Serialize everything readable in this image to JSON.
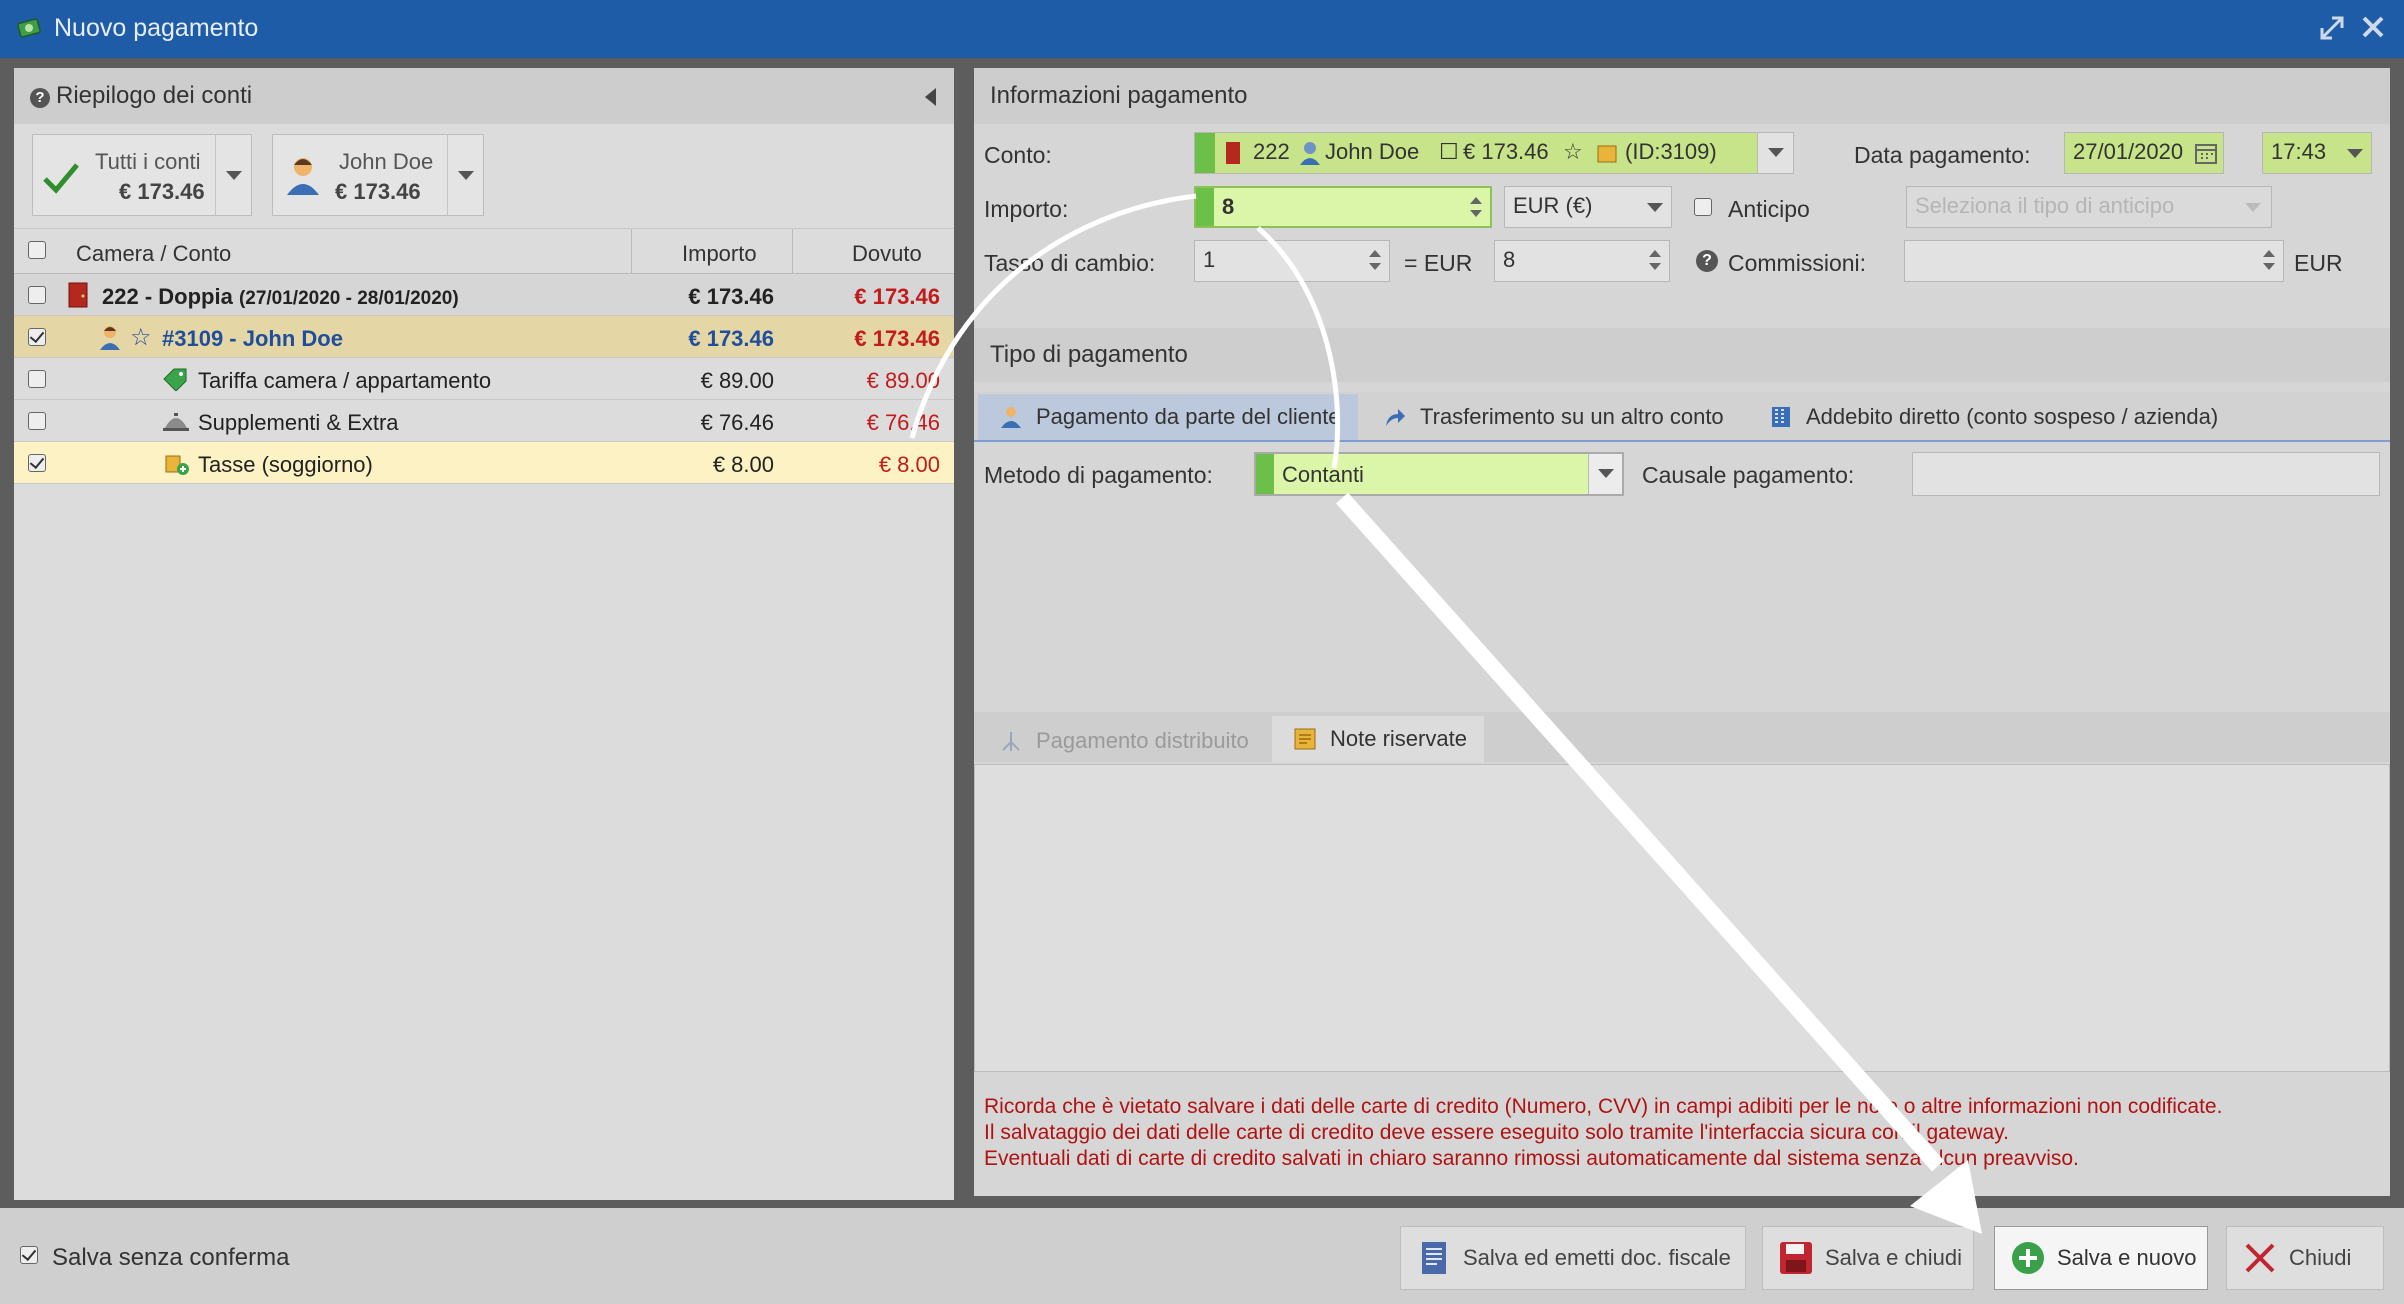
{
  "window": {
    "title": "Nuovo pagamento",
    "expand_icon": "expand-icon",
    "close_icon": "close-icon"
  },
  "left_panel": {
    "title": "Riepilogo dei conti",
    "account_buttons": [
      {
        "label": "Tutti i conti",
        "amount": "€ 173.46"
      },
      {
        "label": "John Doe",
        "amount": "€ 173.46"
      }
    ],
    "grid": {
      "columns": [
        "Camera / Conto",
        "Importo",
        "Dovuto"
      ],
      "rows": [
        {
          "label": "222 - Doppia",
          "dates": "(27/01/2020 - 28/01/2020)",
          "importo": "€ 173.46",
          "dovuto": "€ 173.46",
          "checked": false
        },
        {
          "label": "#3109 - John Doe",
          "importo": "€ 173.46",
          "dovuto": "€ 173.46",
          "checked": true
        },
        {
          "label": "Tariffa camera / appartamento",
          "importo": "€ 89.00",
          "dovuto": "€ 89.00",
          "checked": false
        },
        {
          "label": "Supplementi & Extra",
          "importo": "€ 76.46",
          "dovuto": "€ 76.46",
          "checked": false
        },
        {
          "label": "Tasse (soggiorno)",
          "importo": "€ 8.00",
          "dovuto": "€ 8.00",
          "checked": true
        }
      ]
    }
  },
  "payment_info": {
    "title": "Informazioni pagamento",
    "conto_label": "Conto:",
    "conto_value": {
      "room": "222",
      "guest": "John Doe",
      "amount": "€ 173.46",
      "id": "(ID:3109)"
    },
    "data_label": "Data pagamento:",
    "data_value": "27/01/2020",
    "time_value": "17:43",
    "importo_label": "Importo:",
    "importo_value": "8",
    "currency_value": "EUR (€)",
    "anticipo_label": "Anticipo",
    "anticipo_placeholder": "Seleziona il tipo di anticipo",
    "tasso_label": "Tasso di cambio:",
    "tasso_value": "1",
    "eq_label": "= EUR",
    "converted_value": "8",
    "commissioni_label": "Commissioni:",
    "commissioni_value": "",
    "commissioni_currency": "EUR"
  },
  "payment_type": {
    "title": "Tipo di pagamento",
    "tabs": [
      "Pagamento da parte del cliente",
      "Trasferimento su un altro conto",
      "Addebito diretto (conto sospeso / azienda)"
    ],
    "metodo_label": "Metodo di pagamento:",
    "metodo_value": "Contanti",
    "causale_label": "Causale pagamento:",
    "causale_value": ""
  },
  "notes": {
    "tabs": [
      "Pagamento distribuito",
      "Note riservate"
    ],
    "content": ""
  },
  "warning_lines": [
    "Ricorda che è vietato salvare i dati delle carte di credito (Numero, CVV) in campi adibiti per le note o altre informazioni non codificate.",
    "Il salvataggio dei dati delle carte di credito deve essere eseguito solo tramite l'interfaccia sicura con il gateway.",
    "Eventuali dati di carte di credito salvati in chiaro saranno rimossi automaticamente dal sistema senza alcun preavviso."
  ],
  "footer": {
    "save_without_confirm": "Salva senza conferma",
    "buttons": {
      "save_fiscal": "Salva ed emetti doc. fiscale",
      "save_close": "Salva e chiudi",
      "save_new": "Salva e nuovo",
      "close": "Chiudi"
    }
  },
  "colors": {
    "titlebar": "#1f5ca8",
    "highlight_green": "#dbf6a8",
    "due_red": "#c21b1b",
    "selected_row": "#fdf2c4",
    "guest_row": "#e5d6a6"
  }
}
